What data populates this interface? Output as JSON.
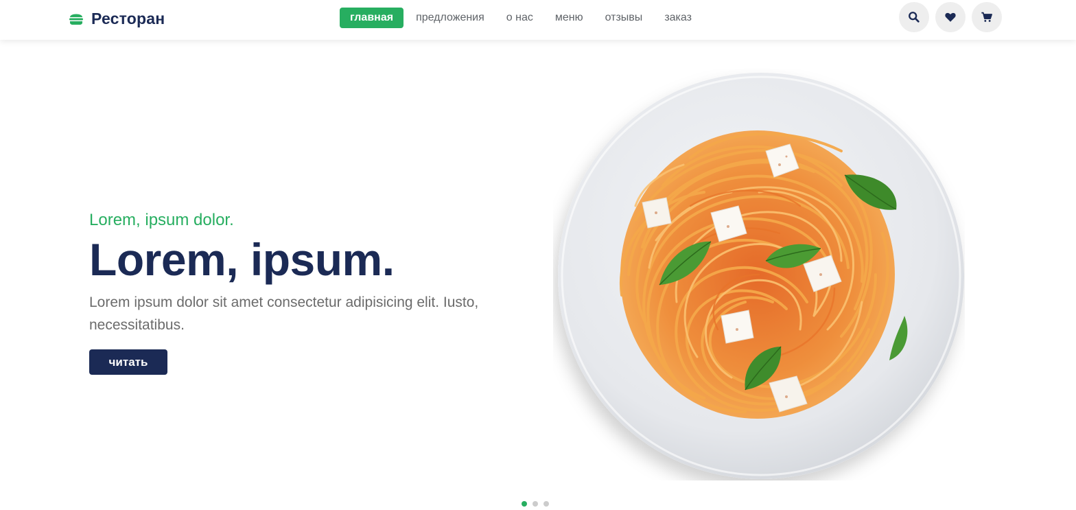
{
  "brand": {
    "name": "Ресторан",
    "icon": "hamburger-icon",
    "accent_color": "#27ae60",
    "primary_color": "#1b2a55"
  },
  "nav": {
    "items": [
      {
        "label": "главная",
        "active": true
      },
      {
        "label": "предложения",
        "active": false
      },
      {
        "label": "о нас",
        "active": false
      },
      {
        "label": "меню",
        "active": false
      },
      {
        "label": "отзывы",
        "active": false
      },
      {
        "label": "заказ",
        "active": false
      }
    ]
  },
  "actions": {
    "search_icon": "search-icon",
    "favorites_icon": "heart-icon",
    "cart_icon": "cart-icon"
  },
  "hero": {
    "subtitle": "Lorem, ipsum dolor.",
    "title": "Lorem, ipsum.",
    "description": "Lorem ipsum dolor sit amet consectetur adipisicing elit. Iusto, necessitatibus.",
    "button_label": "читать",
    "image": "pasta-plate-image"
  },
  "slider": {
    "slides": 3,
    "active_index": 0
  }
}
